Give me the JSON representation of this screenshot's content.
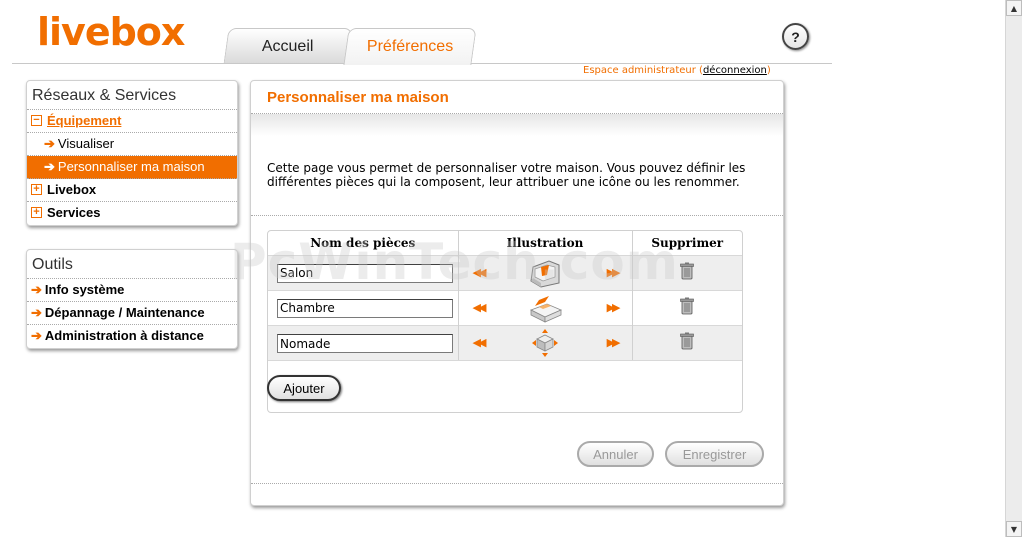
{
  "header": {
    "logo": "livebox",
    "tabs": [
      {
        "label": "Accueil"
      },
      {
        "label": "Préférences"
      }
    ],
    "help": "?",
    "admin_text": "Espace administrateur",
    "logout_open": "(",
    "logout": "déconnexion",
    "logout_close": ")"
  },
  "sidebar": {
    "networks": {
      "title": "Réseaux & Services",
      "items": [
        {
          "label": "Équipement",
          "icon": "minus-box-icon"
        },
        {
          "label": "Visualiser"
        },
        {
          "label": "Personnaliser ma maison"
        },
        {
          "label": "Livebox",
          "icon": "plus-box-icon"
        },
        {
          "label": "Services",
          "icon": "plus-box-icon"
        }
      ]
    },
    "tools": {
      "title": "Outils",
      "items": [
        {
          "label": "Info système"
        },
        {
          "label": "Dépannage / Maintenance"
        },
        {
          "label": "Administration à distance"
        }
      ]
    }
  },
  "main": {
    "title": "Personnaliser ma maison",
    "description": "Cette page vous permet de personnaliser votre maison. Vous pouvez définir les différentes pièces qui la composent, leur attribuer une icône ou les renommer.",
    "table": {
      "headers": [
        "Nom des pièces",
        "Illustration",
        "Supprimer"
      ],
      "rows": [
        {
          "name": "Salon",
          "icon": "armchair-icon"
        },
        {
          "name": "Chambre",
          "icon": "bed-icon"
        },
        {
          "name": "Nomade",
          "icon": "nomad-cube-icon"
        }
      ]
    },
    "add_button": "Ajouter",
    "cancel_button": "Annuler",
    "save_button": "Enregistrer"
  },
  "watermark": "PcWinTech.com",
  "colors": {
    "accent": "#f16e00",
    "disabled": "#999999"
  }
}
